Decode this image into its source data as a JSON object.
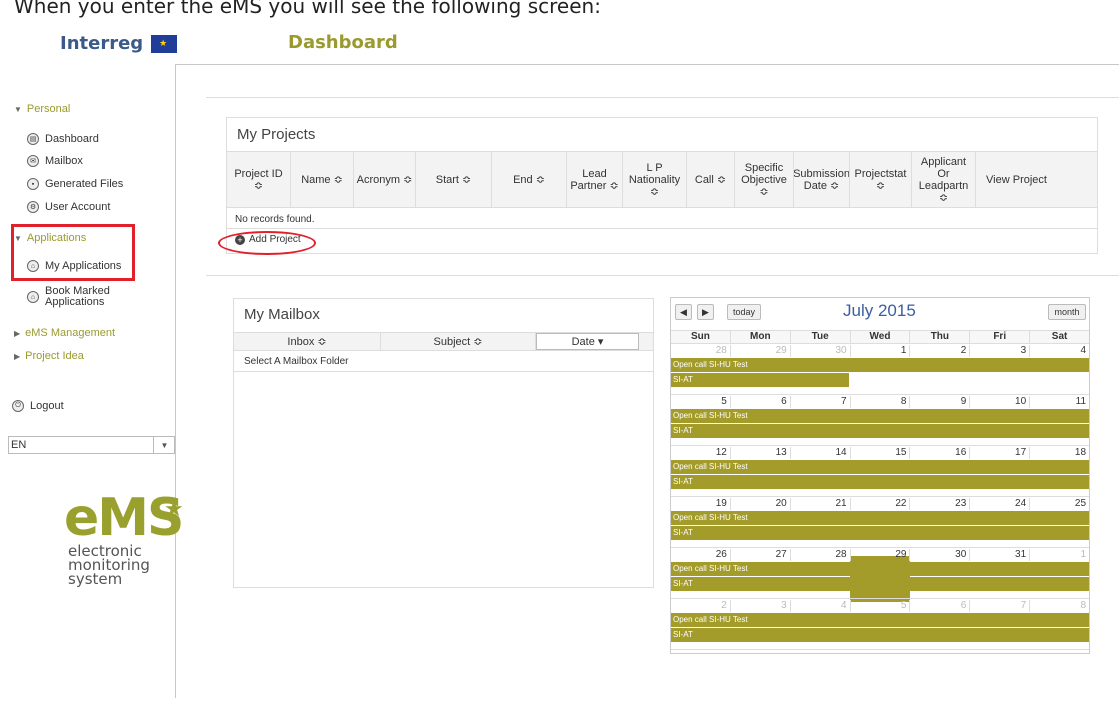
{
  "caption": "When you enter the eMS you will see the following screen:",
  "header": {
    "logo_text": "Interreg",
    "page_title": "Dashboard"
  },
  "sidebar": {
    "personal_label": "Personal",
    "personal_items": [
      "Dashboard",
      "Mailbox",
      "Generated Files",
      "User Account"
    ],
    "applications_label": "Applications",
    "applications_items": [
      "My Applications",
      "Book Marked Applications"
    ],
    "ems_management_label": "eMS Management",
    "project_idea_label": "Project Idea",
    "logout_label": "Logout",
    "language": "EN"
  },
  "ems_logo": {
    "big": "eMS",
    "line1": "electronic",
    "line2": "monitoring",
    "line3": "system"
  },
  "projects": {
    "title": "My Projects",
    "columns": [
      "Project ID ≎",
      "Name ≎",
      "Acronym ≎",
      "Start ≎",
      "End ≎",
      "Lead Partner ≎",
      "L P Nationality ≎",
      "Call ≎",
      "Specific Objective ≎",
      "Submission Date ≎",
      "Projectstat ≎",
      "Applicant Or Leadpartn ≎",
      "View Project"
    ],
    "empty_text": "No records found.",
    "add_label": "Add Project"
  },
  "mailbox": {
    "title": "My Mailbox",
    "columns": [
      "Inbox ≎",
      "Subject ≎",
      "Date ▾"
    ],
    "row_text": "Select A Mailbox Folder"
  },
  "calendar": {
    "month_title": "July 2015",
    "today_label": "today",
    "month_label": "month",
    "weekdays": [
      "Sun",
      "Mon",
      "Tue",
      "Wed",
      "Thu",
      "Fri",
      "Sat"
    ],
    "weeks": [
      [
        "28",
        "29",
        "30",
        "1",
        "2",
        "3",
        "4"
      ],
      [
        "5",
        "6",
        "7",
        "8",
        "9",
        "10",
        "11"
      ],
      [
        "12",
        "13",
        "14",
        "15",
        "16",
        "17",
        "18"
      ],
      [
        "19",
        "20",
        "21",
        "22",
        "23",
        "24",
        "25"
      ],
      [
        "26",
        "27",
        "28",
        "29",
        "30",
        "31",
        "1"
      ],
      [
        "2",
        "3",
        "4",
        "5",
        "6",
        "7",
        "8"
      ]
    ],
    "event1": "Open call SI-HU Test",
    "event2": "SI-AT",
    "event_color": "#a39c2a"
  }
}
